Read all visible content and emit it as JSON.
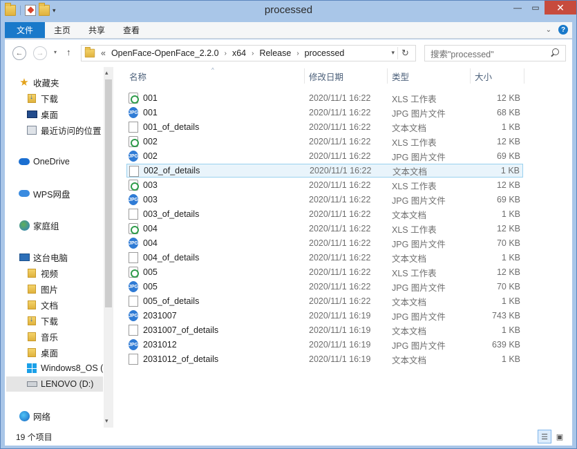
{
  "window": {
    "title": "processed"
  },
  "ribbon": {
    "tabs": [
      "文件",
      "主页",
      "共享",
      "查看"
    ]
  },
  "nav": {
    "breadcrumbs": [
      "OpenFace-OpenFace_2.2.0",
      "x64",
      "Release",
      "processed"
    ],
    "overflow": "«",
    "search_placeholder": "搜索\"processed\""
  },
  "sidebar": {
    "items": [
      {
        "label": "收藏夹",
        "icon": "star-icon"
      },
      {
        "label": "下载",
        "icon": "downloads-folder-icon"
      },
      {
        "label": "桌面",
        "icon": "desktop-icon"
      },
      {
        "label": "最近访问的位置",
        "icon": "recent-places-icon"
      },
      {
        "label": "OneDrive",
        "icon": "onedrive-icon"
      },
      {
        "label": "WPS网盘",
        "icon": "wps-cloud-icon"
      },
      {
        "label": "家庭组",
        "icon": "homegroup-icon"
      },
      {
        "label": "这台电脑",
        "icon": "computer-icon"
      },
      {
        "label": "视频",
        "icon": "videos-folder-icon"
      },
      {
        "label": "图片",
        "icon": "pictures-folder-icon"
      },
      {
        "label": "文档",
        "icon": "documents-folder-icon"
      },
      {
        "label": "下载",
        "icon": "downloads-folder-icon"
      },
      {
        "label": "音乐",
        "icon": "music-folder-icon"
      },
      {
        "label": "桌面",
        "icon": "desktop-folder-icon"
      },
      {
        "label": "Windows8_OS (",
        "icon": "windows-drive-icon"
      },
      {
        "label": "LENOVO (D:)",
        "icon": "drive-icon"
      },
      {
        "label": "网络",
        "icon": "network-icon"
      }
    ]
  },
  "columns": {
    "name": "名称",
    "date": "修改日期",
    "type": "类型",
    "size": "大小"
  },
  "files": [
    {
      "name": "001",
      "date": "2020/11/1 16:22",
      "type": "XLS 工作表",
      "size": "12 KB",
      "kind": "xls"
    },
    {
      "name": "001",
      "date": "2020/11/1 16:22",
      "type": "JPG 图片文件",
      "size": "68 KB",
      "kind": "jpg"
    },
    {
      "name": "001_of_details",
      "date": "2020/11/1 16:22",
      "type": "文本文档",
      "size": "1 KB",
      "kind": "txt"
    },
    {
      "name": "002",
      "date": "2020/11/1 16:22",
      "type": "XLS 工作表",
      "size": "12 KB",
      "kind": "xls"
    },
    {
      "name": "002",
      "date": "2020/11/1 16:22",
      "type": "JPG 图片文件",
      "size": "69 KB",
      "kind": "jpg"
    },
    {
      "name": "002_of_details",
      "date": "2020/11/1 16:22",
      "type": "文本文档",
      "size": "1 KB",
      "kind": "txt",
      "selected": true
    },
    {
      "name": "003",
      "date": "2020/11/1 16:22",
      "type": "XLS 工作表",
      "size": "12 KB",
      "kind": "xls"
    },
    {
      "name": "003",
      "date": "2020/11/1 16:22",
      "type": "JPG 图片文件",
      "size": "69 KB",
      "kind": "jpg"
    },
    {
      "name": "003_of_details",
      "date": "2020/11/1 16:22",
      "type": "文本文档",
      "size": "1 KB",
      "kind": "txt"
    },
    {
      "name": "004",
      "date": "2020/11/1 16:22",
      "type": "XLS 工作表",
      "size": "12 KB",
      "kind": "xls"
    },
    {
      "name": "004",
      "date": "2020/11/1 16:22",
      "type": "JPG 图片文件",
      "size": "70 KB",
      "kind": "jpg"
    },
    {
      "name": "004_of_details",
      "date": "2020/11/1 16:22",
      "type": "文本文档",
      "size": "1 KB",
      "kind": "txt"
    },
    {
      "name": "005",
      "date": "2020/11/1 16:22",
      "type": "XLS 工作表",
      "size": "12 KB",
      "kind": "xls"
    },
    {
      "name": "005",
      "date": "2020/11/1 16:22",
      "type": "JPG 图片文件",
      "size": "70 KB",
      "kind": "jpg"
    },
    {
      "name": "005_of_details",
      "date": "2020/11/1 16:22",
      "type": "文本文档",
      "size": "1 KB",
      "kind": "txt"
    },
    {
      "name": "2031007",
      "date": "2020/11/1 16:19",
      "type": "JPG 图片文件",
      "size": "743 KB",
      "kind": "jpg"
    },
    {
      "name": "2031007_of_details",
      "date": "2020/11/1 16:19",
      "type": "文本文档",
      "size": "1 KB",
      "kind": "txt"
    },
    {
      "name": "2031012",
      "date": "2020/11/1 16:19",
      "type": "JPG 图片文件",
      "size": "639 KB",
      "kind": "jpg"
    },
    {
      "name": "2031012_of_details",
      "date": "2020/11/1 16:19",
      "type": "文本文档",
      "size": "1 KB",
      "kind": "txt"
    }
  ],
  "status": {
    "item_count": "19 个项目"
  },
  "icons": {
    "jpg_badge": "JPG"
  },
  "colors": {
    "accent": "#1979ca",
    "close": "#c74b3d",
    "selection": "#e9f4fb"
  }
}
